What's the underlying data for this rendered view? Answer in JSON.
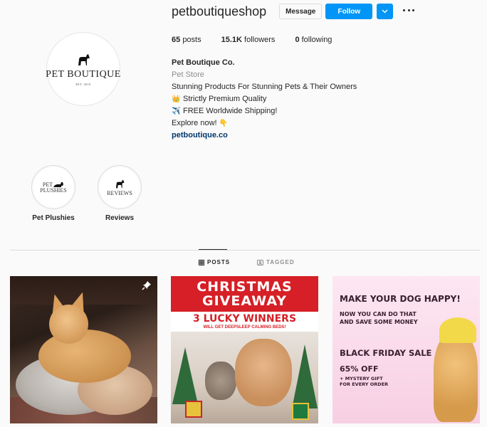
{
  "profile": {
    "username": "petboutiqueshop",
    "avatar_brand": "PET BOUTIQUE",
    "avatar_est": "EST. 2019",
    "message_label": "Message",
    "follow_label": "Follow"
  },
  "stats": {
    "posts_count": "65",
    "posts_label": "posts",
    "followers_count": "15.1K",
    "followers_label": "followers",
    "following_count": "0",
    "following_label": "following"
  },
  "bio": {
    "name": "Pet Boutique Co.",
    "category": "Pet Store",
    "line1": "Stunning Products For Stunning Pets & Their Owners",
    "line2": "Strictly Premium Quality",
    "line3": "FREE Worldwide Shipping!",
    "line4": "Explore now!",
    "link": "petboutique.co",
    "emoji_line2": "👑",
    "emoji_line3": "✈️",
    "emoji_line4": "👇"
  },
  "highlights": [
    {
      "label": "Pet Plushies",
      "cover_text_1": "PET",
      "cover_text_2": "PLUSHIES"
    },
    {
      "label": "Reviews",
      "cover_text_1": "REVIEWS"
    }
  ],
  "tabs": [
    {
      "label": "POSTS",
      "active": true
    },
    {
      "label": "TAGGED",
      "active": false
    }
  ],
  "posts": {
    "p2_title_1": "CHRISTMAS",
    "p2_title_2": "GIVEAWAY",
    "p2_winners": "3 LUCKY WINNERS",
    "p2_sub": "WILL GET DEEPSLEEP CALMING BEDS!",
    "p3_title": "MAKE YOUR DOG HAPPY!",
    "p3_line1": "NOW YOU CAN DO THAT",
    "p3_line2": "AND SAVE SOME MONEY",
    "p3_bf": "BLACK FRIDAY SALE",
    "p3_off": "65% OFF",
    "p3_gift1": "+ MYSTERY GIFT",
    "p3_gift2": "FOR EVERY ORDER"
  },
  "colors": {
    "accent": "#0095f6",
    "link": "#00376b",
    "muted": "#8e8e8e",
    "border": "#dbdbdb",
    "christmas_red": "#d61f26"
  }
}
